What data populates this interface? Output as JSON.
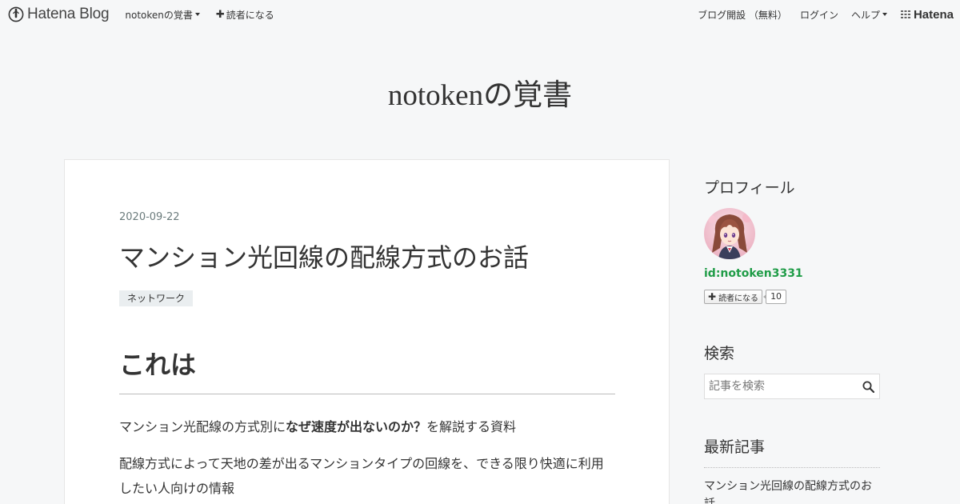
{
  "header": {
    "logo_text": "Hatena Blog",
    "blog_menu_label": "notokenの覚書",
    "subscribe_label": "読者になる",
    "open_blog_label": "ブログ開設 （無料）",
    "login_label": "ログイン",
    "help_label": "ヘルプ",
    "hatena_label": "Hatena"
  },
  "blog": {
    "title": "notokenの覚書"
  },
  "entry": {
    "date": "2020-09-22",
    "title": "マンション光回線の配線方式のお話",
    "category": "ネットワーク",
    "section_heading": "これは",
    "para1_before": "マンション光配線の方式別に",
    "para1_bold": "なぜ速度が出ないのか？",
    "para1_after": "を解説する資料",
    "para2": "配線方式によって天地の差が出るマンションタイプの回線を、できる限り快適に利用したい人向けの情報"
  },
  "sidebar": {
    "profile_title": "プロフィール",
    "profile_id": "id:notoken3331",
    "subscribe_label": "読者になる",
    "subscriber_count": "10",
    "search_title": "検索",
    "search_placeholder": "記事を検索",
    "recent_title": "最新記事",
    "recent_items": [
      "マンション光回線の配線方式のお話"
    ]
  },
  "colors": {
    "page_bg": "#f6f7f8",
    "profile_id": "#1f9c47",
    "date": "#6b7b7c"
  }
}
